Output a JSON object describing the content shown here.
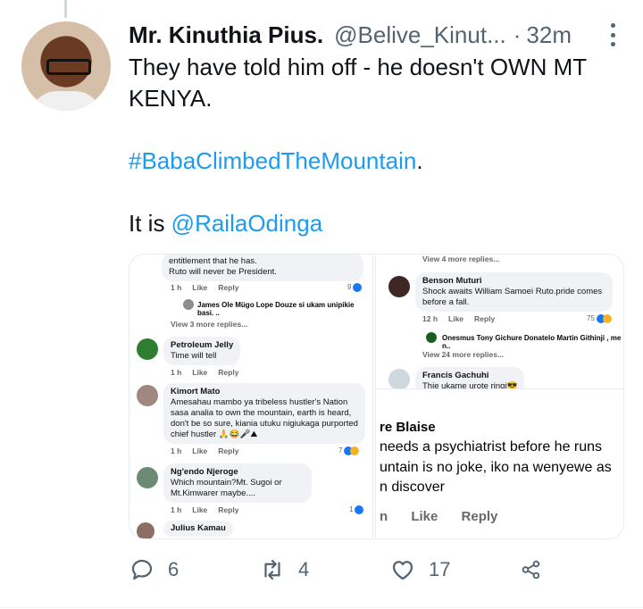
{
  "tweet": {
    "author_name": "Mr. Kinuthia Pius.",
    "handle": "@Belive_Kinut...",
    "dot": "·",
    "time": "32m",
    "line1": "They have told him off - he doesn't OWN MT KENYA.",
    "hashtag": "#BabaClimbedTheMountain",
    "hashtag_suffix": ".",
    "line3_prefix": "It is ",
    "mention": "@RailaOdinga"
  },
  "left_shot": {
    "top_text1": "entitlement that he has.",
    "top_text2": "Ruto will never be President.",
    "c1_meta_time": "1 h",
    "c1_like": "Like",
    "c1_reply": "Reply",
    "c1_count": "9",
    "reply1": "James Ole Mügo Lope Douze si ukam unipikie basi. ..",
    "view_more1": "View 3 more replies...",
    "c2_name": "Petroleum Jelly",
    "c2_text": "Time will tell",
    "c2_time": "1 h",
    "c2_like": "Like",
    "c2_reply": "Reply",
    "c3_name": "Kimort Mato",
    "c3_text": "Amesahau mambo ya tribeless hustler's Nation sasa analia to own the mountain, earth is heard, don't be so sure, kiania utuku nigiukaga purported chief hustler 🙏😂🎤⛰",
    "c3_time": "1 h",
    "c3_like": "Like",
    "c3_reply": "Reply",
    "c3_count": "7",
    "c4_name": "Ng'endo Njeroge",
    "c4_text": "Which mountain?Mt. Sugoi or Mt.Kimwarer maybe....",
    "c4_time": "1 h",
    "c4_like": "Like",
    "c4_reply": "Reply",
    "c4_count": "1",
    "c5_name": "Julius Kamau"
  },
  "right_shot": {
    "view_more_top": "View 4 more replies...",
    "c1_name": "Benson Muturi",
    "c1_text": "Shock awaits William Samoei Ruto.pride comes before a fall.",
    "c1_time": "12 h",
    "c1_like": "Like",
    "c1_reply": "Reply",
    "c1_count": "75",
    "reply1": "Onesmus Tony Gichure Donatelo Martin Githinji , me n..",
    "view_more2": "View 24 more replies...",
    "c2_name": "Francis Gachuhi",
    "c2_text": "Thie ukame urote ringi😎",
    "big_name": "re Blaise",
    "big_l1": "needs a psychiatrist before he runs",
    "big_l2": "untain is no joke, iko na wenyewe as",
    "big_l3": "n discover",
    "big_n": "n",
    "big_like": "Like",
    "big_reply": "Reply"
  },
  "actions": {
    "replies": "6",
    "retweets": "4",
    "likes": "17"
  }
}
